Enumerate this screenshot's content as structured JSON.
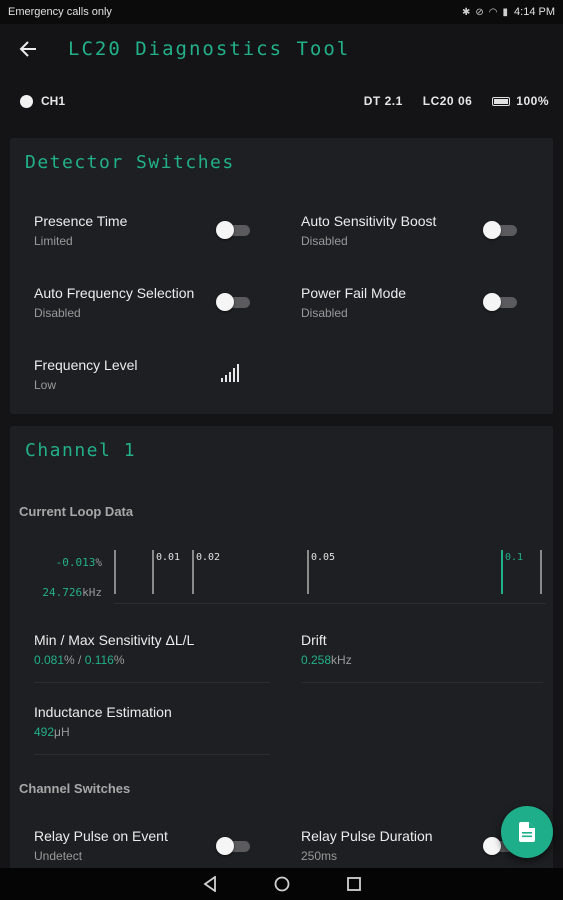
{
  "status_bar": {
    "left_text": "Emergency calls only",
    "time": "4:14 PM"
  },
  "app_bar": {
    "title": "LC20 Diagnostics Tool"
  },
  "info": {
    "channel": "CH1",
    "dt": "DT 2.1",
    "model": "LC20 06",
    "battery": "100%"
  },
  "detector_switches": {
    "title": "Detector Switches",
    "presence_time": {
      "label": "Presence Time",
      "value": "Limited",
      "on": false
    },
    "auto_sensitivity_boost": {
      "label": "Auto Sensitivity Boost",
      "value": "Disabled",
      "on": false
    },
    "auto_frequency_selection": {
      "label": "Auto Frequency Selection",
      "value": "Disabled",
      "on": false
    },
    "power_fail_mode": {
      "label": "Power Fail Mode",
      "value": "Disabled",
      "on": false
    },
    "frequency_level": {
      "label": "Frequency Level",
      "value": "Low",
      "icon": "signal-bars-icon"
    }
  },
  "channel": {
    "title": "Channel 1",
    "current_loop_label": "Current Loop Data",
    "loop": {
      "delta": "-0.013",
      "delta_unit": "%",
      "frequency": "24.726",
      "frequency_unit": "kHz",
      "ticks": [
        {
          "label": "",
          "color": "#8a8a8a"
        },
        {
          "label": "0.01",
          "color": "#8a8a8a"
        },
        {
          "label": "0.02",
          "color": "#8a8a8a"
        },
        {
          "label": "0.05",
          "color": "#8a8a8a"
        },
        {
          "label": "0.1",
          "color": "#22b08a"
        }
      ]
    },
    "min_max": {
      "label": "Min / Max Sensitivity ΔL/L",
      "min": "0.081",
      "unit1": "%",
      "separator": " / ",
      "max": "0.116",
      "unit2": "%"
    },
    "drift": {
      "label": "Drift",
      "value": "0.258",
      "unit": "kHz"
    },
    "inductance": {
      "label": "Inductance Estimation",
      "value": "492",
      "unit": "μH"
    },
    "channel_switches_label": "Channel Switches",
    "relay_pulse_event": {
      "label": "Relay Pulse on Event",
      "value": "Undetect",
      "on": false
    },
    "relay_pulse_duration": {
      "label": "Relay Pulse Duration",
      "value": "250ms",
      "on": false
    }
  },
  "colors": {
    "accent": "#22b08a",
    "background": "#141416",
    "card": "#1e1f22"
  }
}
